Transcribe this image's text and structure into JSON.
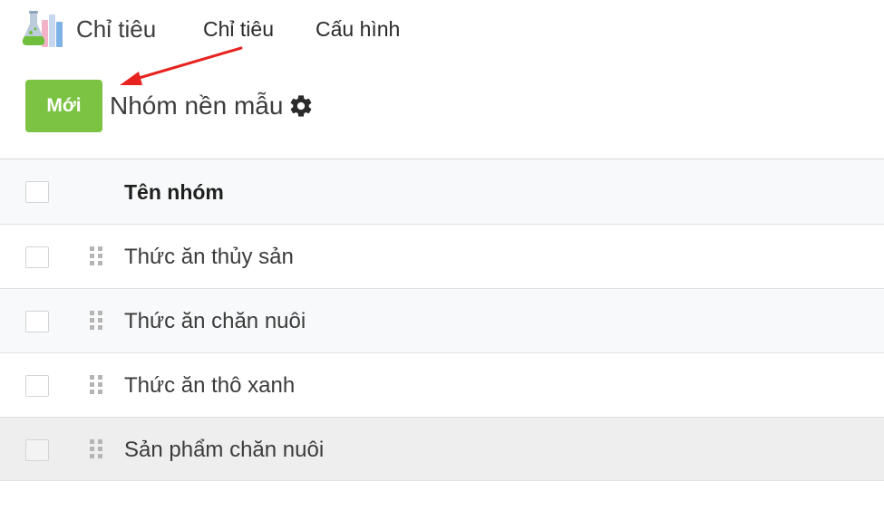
{
  "app": {
    "icon": "lab-chart-icon",
    "title": "Chỉ tiêu"
  },
  "nav": {
    "menu": [
      "Chỉ tiêu",
      "Cấu hình"
    ]
  },
  "control_panel": {
    "new_label": "Mới",
    "breadcrumb": "Nhóm nền mẫu",
    "settings_icon": "gear-icon",
    "new_button_color": "#7cc243"
  },
  "annotation": {
    "arrow_color": "#e8231f"
  },
  "table": {
    "column_header": "Tên nhóm",
    "rows": [
      "Thức ăn thủy sản",
      "Thức ăn chăn nuôi",
      "Thức ăn thô xanh",
      "Sản phẩm chăn nuôi"
    ]
  }
}
